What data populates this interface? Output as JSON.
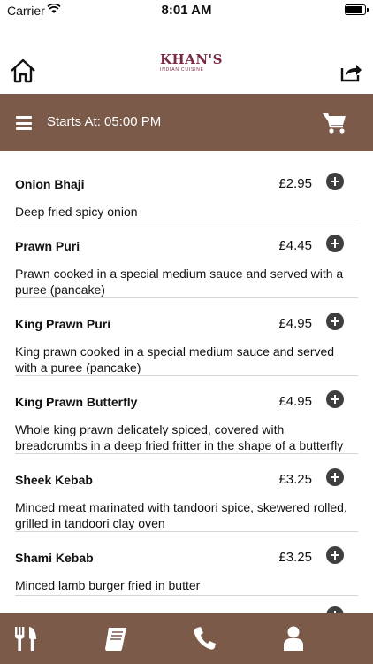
{
  "status": {
    "carrier": "Carrier",
    "time": "8:01 AM"
  },
  "header": {
    "brand": "KHAN'S",
    "brand_sub": "INDIAN CUISINE"
  },
  "banner": {
    "starts_label": "Starts At: 05:00 PM"
  },
  "menu_items": [
    {
      "name": "Onion Bhaji",
      "price": "£2.95",
      "desc": "Deep fried spicy onion"
    },
    {
      "name": "Prawn Puri",
      "price": "£4.45",
      "desc": "Prawn cooked in a special medium sauce and served with a puree (pancake)"
    },
    {
      "name": "King Prawn Puri",
      "price": "£4.95",
      "desc": "King prawn cooked in a special medium sauce and served with a puree (pancake)"
    },
    {
      "name": "King Prawn Butterfly",
      "price": "£4.95",
      "desc": "Whole king prawn delicately spiced, covered with breadcrumbs in a deep fried fritter in the shape of a butterfly"
    },
    {
      "name": "Sheek Kebab",
      "price": "£3.25",
      "desc": "Minced meat marinated with tandoori spice, skewered rolled, grilled in tandoori clay oven"
    },
    {
      "name": "Shami Kebab",
      "price": "£3.25",
      "desc": "Minced lamb burger fried in butter"
    }
  ],
  "tabs": [
    {
      "icon": "cutlery-icon"
    },
    {
      "icon": "menu-book-icon"
    },
    {
      "icon": "phone-icon"
    },
    {
      "icon": "user-icon"
    }
  ],
  "colors": {
    "accent": "#7b5a4a",
    "brand": "#7a2a45"
  }
}
